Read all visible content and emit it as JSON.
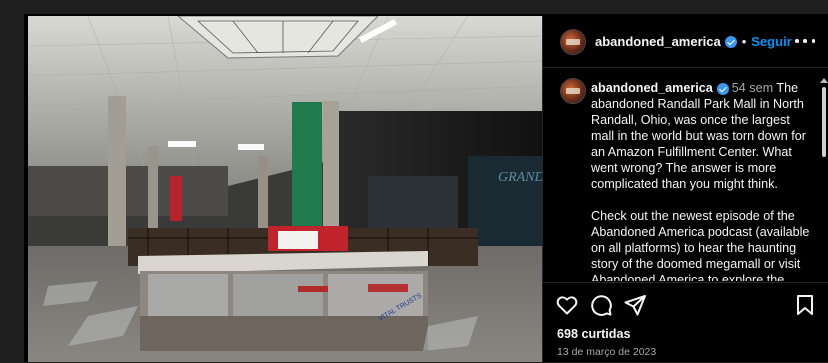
{
  "post": {
    "image_alt": "",
    "sign_left": "VITAL TRUSTS",
    "store_sign": "GRAND"
  },
  "header": {
    "username": "abandoned_america",
    "separator": "•",
    "follow_label": "Seguir",
    "more_icon": "more-horizontal-icon"
  },
  "caption": {
    "username": "abandoned_america",
    "time_ago": "54 sem",
    "paragraph_1": "The abandoned Randall Park Mall in North Randall, Ohio, was once the largest mall in the world but was torn down for an Amazon Fulfillment Center. What went wrong? The answer is more complicated than you might think.",
    "paragraph_2": "Check out the newest episode of the Abandoned America podcast (available on all platforms) to hear the haunting story of the doomed megamall or visit Abandoned America to explore the"
  },
  "actions": {
    "like_icon": "heart-icon",
    "comment_icon": "comment-icon",
    "share_icon": "send-icon",
    "save_icon": "bookmark-icon",
    "likes_text": "698 curtidas",
    "date_text": "13 de março de 2023"
  },
  "colors": {
    "accent_link": "#0095f6",
    "verified": "#3897f0",
    "background": "#000000",
    "muted_text": "#a8a8a8"
  }
}
